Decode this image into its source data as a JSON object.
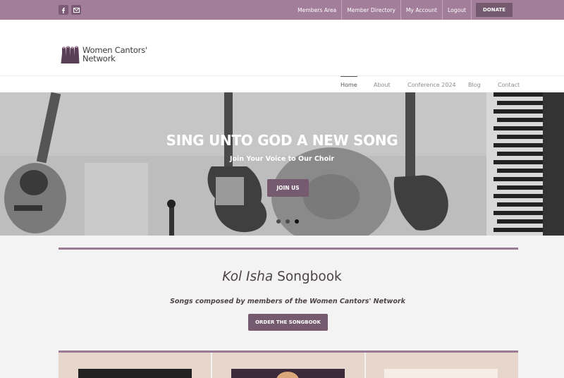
{
  "topbar": {
    "social_icons": [
      "facebook-icon",
      "mail-icon"
    ],
    "links": [
      "Members Area",
      "Member Directory",
      "My Account",
      "Logout"
    ],
    "donate_label": "DONATE"
  },
  "logo": {
    "line1": "Women Cantors'",
    "line2": "Network"
  },
  "nav": {
    "items": [
      "Home",
      "About",
      "Conference 2024",
      "Blog",
      "Contact"
    ],
    "active": "Home"
  },
  "hero": {
    "title": "SING UNTO GOD A NEW SONG",
    "subtitle": "Join Your Voice to Our Choir",
    "button": "JOIN US",
    "slides": 3,
    "active_slide": 3
  },
  "songbook": {
    "title_italic": "Kol Isha",
    "title_rest": "Songbook",
    "subtitle": "Songs composed by members of the Women Cantors' Network",
    "button": "ORDER THE SONGBOOK"
  },
  "colors": {
    "topbar": "#a27e9b",
    "accent": "#755a70",
    "rule": "#9b7a95",
    "tile": "#e6d6cb"
  }
}
